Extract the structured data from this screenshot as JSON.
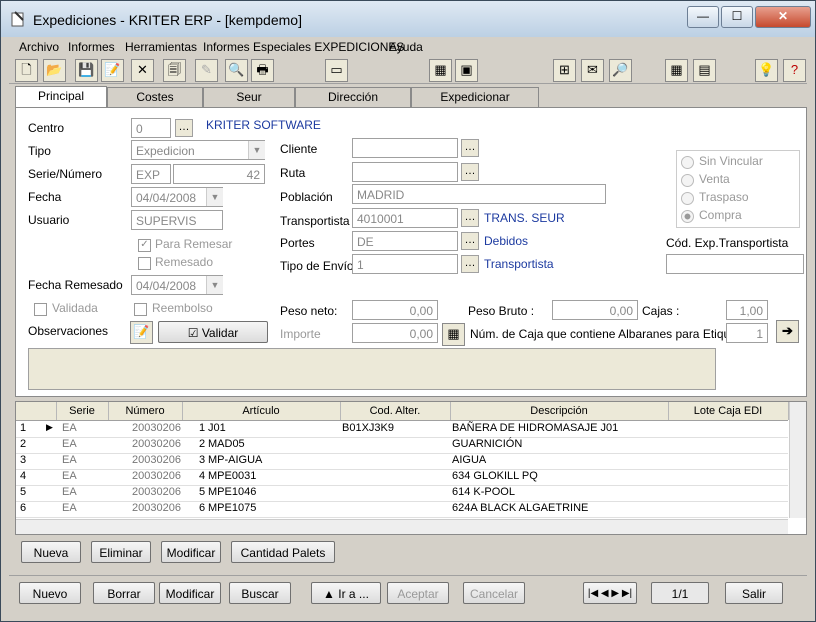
{
  "window": {
    "title": "Expediciones - KRITER ERP - [kempdemo]",
    "minimize": "—",
    "maximize": "☐",
    "close": "✕"
  },
  "menu": [
    "Archivo",
    "Informes",
    "Herramientas",
    "Informes Especiales EXPEDICIONES",
    "Ayuda"
  ],
  "toolbar_icons": [
    "new-icon",
    "open-icon",
    "save-icon",
    "edit-icon",
    "delete-icon",
    "print-preview-icon",
    "disabled-icon",
    "preview-icon",
    "printer-icon",
    "window-icon",
    "calculator-icon",
    "save-disk-icon",
    "tree-icon",
    "mail-icon",
    "search-doc-icon",
    "grid-icon",
    "calculator-small-icon",
    "lightbulb-icon",
    "help-icon"
  ],
  "tabs": [
    "Principal",
    "Costes",
    "Seur",
    "Dirección",
    "Expedicionar"
  ],
  "form": {
    "centro_label": "Centro",
    "centro_value": "0",
    "centro_name": "KRITER SOFTWARE",
    "tipo_label": "Tipo",
    "tipo_value": "Expedicion",
    "serie_label": "Serie/Número",
    "serie_value": "EXP",
    "numero_value": "42",
    "fecha_label": "Fecha",
    "fecha_value": "04/04/2008",
    "usuario_label": "Usuario",
    "usuario_value": "SUPERVIS",
    "para_remesar_label": "Para Remesar",
    "remesado_label": "Remesado",
    "fecha_remesado_label": "Fecha Remesado",
    "fecha_remesado_value": "04/04/2008",
    "validada_label": "Validada",
    "reembolso_label": "Reembolso",
    "observaciones_label": "Observaciones",
    "validar_label": "Validar",
    "cliente_label": "Cliente",
    "ruta_label": "Ruta",
    "poblacion_label": "Población",
    "poblacion_value": "MADRID",
    "transportista_label": "Transportista",
    "transportista_value": "4010001",
    "transportista_name": "TRANS. SEUR",
    "portes_label": "Portes",
    "portes_value": "DE",
    "portes_name": "Debidos",
    "tipo_envio_label": "Tipo de Envío",
    "tipo_envio_value": "1",
    "tipo_envio_name": "Transportista",
    "peso_neto_label": "Peso neto:",
    "peso_neto_value": "0,00",
    "peso_bruto_label": "Peso Bruto :",
    "peso_bruto_value": "0,00",
    "cajas_label": "Cajas :",
    "cajas_value": "1,00",
    "importe_label": "Importe",
    "importe_value": "0,00",
    "num_caja_label": "Núm. de Caja que contiene Albaranes para Etiquetas",
    "num_caja_value": "1",
    "radio_options": [
      "Sin Vincular",
      "Venta",
      "Traspaso",
      "Compra"
    ],
    "cod_exp_label": "Cód. Exp.Transportista"
  },
  "grid": {
    "columns": [
      "Serie",
      "Número",
      "Artículo",
      "Cod. Alter.",
      "Descripción",
      "Lote Caja EDI"
    ],
    "rows": [
      {
        "n": "1",
        "serie": "EA",
        "numero": "20030206",
        "idx": "1",
        "articulo": "J01",
        "cod": "B01XJ3K9",
        "desc": "BAÑERA DE HIDROMASAJE J01"
      },
      {
        "n": "2",
        "serie": "EA",
        "numero": "20030206",
        "idx": "2",
        "articulo": "MAD05",
        "cod": "",
        "desc": "GUARNICIÓN"
      },
      {
        "n": "3",
        "serie": "EA",
        "numero": "20030206",
        "idx": "3",
        "articulo": "MP-AIGUA",
        "cod": "",
        "desc": "AIGUA"
      },
      {
        "n": "4",
        "serie": "EA",
        "numero": "20030206",
        "idx": "4",
        "articulo": "MPE0031",
        "cod": "",
        "desc": "634 GLOKILL PQ"
      },
      {
        "n": "5",
        "serie": "EA",
        "numero": "20030206",
        "idx": "5",
        "articulo": "MPE1046",
        "cod": "",
        "desc": "614 K-POOL"
      },
      {
        "n": "6",
        "serie": "EA",
        "numero": "20030206",
        "idx": "6",
        "articulo": "MPE1075",
        "cod": "",
        "desc": "624A BLACK ALGAETRINE"
      }
    ]
  },
  "grid_buttons": [
    "Nueva",
    "Eliminar",
    "Modificar",
    "Cantidad Palets"
  ],
  "bottom": {
    "nuevo": "Nuevo",
    "borrar": "Borrar",
    "modificar": "Modificar",
    "buscar": "Buscar",
    "ira": "▲ Ir a ...",
    "aceptar": "Aceptar",
    "cancelar": "Cancelar",
    "page": "1/1",
    "salir": "Salir"
  }
}
